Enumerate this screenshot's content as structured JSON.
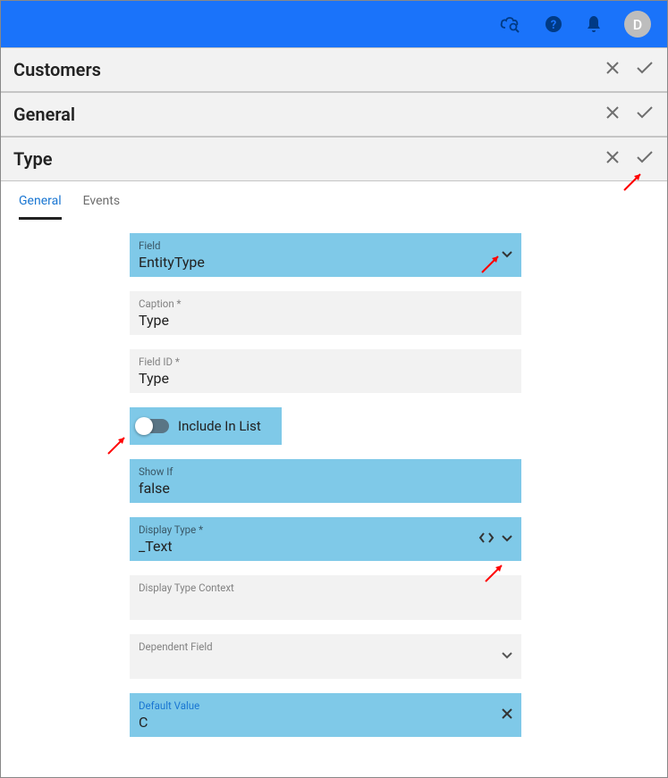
{
  "topbar": {
    "avatar_letter": "D"
  },
  "sections": [
    {
      "title": "Customers"
    },
    {
      "title": "General"
    },
    {
      "title": "Type"
    }
  ],
  "tabs": {
    "general": "General",
    "events": "Events"
  },
  "fields": {
    "field": {
      "label": "Field",
      "value": "EntityType"
    },
    "caption": {
      "label": "Caption *",
      "value": "Type"
    },
    "fieldid": {
      "label": "Field ID *",
      "value": "Type"
    },
    "include": {
      "label": "Include In List"
    },
    "showif": {
      "label": "Show If",
      "value": "false"
    },
    "displaytype": {
      "label": "Display Type *",
      "value": "_Text"
    },
    "displaytypectx": {
      "label": "Display Type Context",
      "value": ""
    },
    "dependent": {
      "label": "Dependent Field",
      "value": ""
    },
    "defaultvalue": {
      "label": "Default Value",
      "value": "C"
    }
  }
}
